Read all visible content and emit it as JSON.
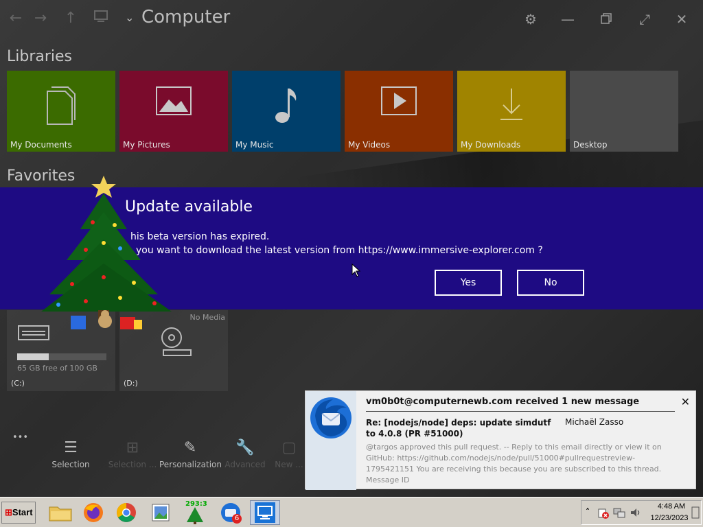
{
  "window": {
    "title": "Computer",
    "libraries_heading": "Libraries",
    "favorites_heading": "Favorites"
  },
  "libraries": [
    {
      "label": "My Documents",
      "color": "#3b6b00",
      "icon": "documents-icon"
    },
    {
      "label": "My Pictures",
      "color": "#7a0b2c",
      "icon": "pictures-icon"
    },
    {
      "label": "My Music",
      "color": "#003f6b",
      "icon": "music-icon"
    },
    {
      "label": "My Videos",
      "color": "#8a2f00",
      "icon": "videos-icon"
    },
    {
      "label": "My Downloads",
      "color": "#a08400",
      "icon": "downloads-icon"
    },
    {
      "label": "Desktop",
      "color": "#4a4a4a",
      "icon": ""
    }
  ],
  "drives": [
    {
      "label": "(C:)",
      "free_text": "65 GB free of 100 GB",
      "used_fraction": 0.35
    },
    {
      "label": "(D:)",
      "status": "No Media"
    }
  ],
  "toolbar": [
    {
      "label": "Selection",
      "enabled": true
    },
    {
      "label": "Selection ...",
      "enabled": false
    },
    {
      "label": "Personalization",
      "enabled": true
    },
    {
      "label": "Advanced",
      "enabled": false
    },
    {
      "label": "New ...",
      "enabled": false
    }
  ],
  "toolbar_more": "•••",
  "dialog": {
    "title": "Update available",
    "line1": "his beta version has expired.",
    "line2": "you want to download the latest version from https://www.immersive-explorer.com ?",
    "yes_label": "Yes",
    "no_label": "No",
    "background": "#1e0b83"
  },
  "notification": {
    "header": "vm0b0t@computernewb.com received 1 new message",
    "subject": "Re: [nodejs/node] deps: update simdutf to 4.0.8 (PR #51000)",
    "sender": "Michaël Zasso",
    "body": "@targos approved this pull request. -- Reply to this email directly or view it on GitHub: https://github.com/nodejs/node/pull/51000#pullrequestreview-1795421151 You are receiving this because you are subscribed to this thread. Message ID",
    "close_label": "✕"
  },
  "taskbar": {
    "start_label": "Start",
    "counter_badge": "293:3",
    "thunderbird_badge": "6",
    "time": "4:48 AM",
    "date": "12/23/2023"
  }
}
